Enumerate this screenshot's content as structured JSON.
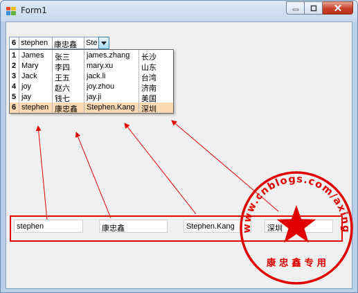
{
  "window": {
    "title": "Form1"
  },
  "combo": {
    "id": "6",
    "name": "stephen",
    "chinese": "康忠鑫",
    "email": "Ste"
  },
  "list": [
    {
      "id": "1",
      "name": "James",
      "chinese": "张三",
      "email": "james.zhang",
      "city": "长沙"
    },
    {
      "id": "2",
      "name": "Mary",
      "chinese": "李四",
      "email": "mary.xu",
      "city": "山东"
    },
    {
      "id": "3",
      "name": "Jack",
      "chinese": "王五",
      "email": "jack.li",
      "city": "台湾"
    },
    {
      "id": "4",
      "name": "joy",
      "chinese": "赵六",
      "email": "joy.zhou",
      "city": "济南"
    },
    {
      "id": "5",
      "name": "jay",
      "chinese": "钱七",
      "email": "jay.ji",
      "city": "美国"
    },
    {
      "id": "6",
      "name": "stephen",
      "chinese": "康忠鑫",
      "email": "Stephen.Kang",
      "city": "深圳"
    }
  ],
  "selected_index": 5,
  "fields": {
    "name": "stephen",
    "chinese": "康忠鑫",
    "email": "Stephen.Kang",
    "city": "深圳"
  },
  "stamp": {
    "arc_text": "www.cnblogs.com/axing",
    "bottom_text": "康 忠 鑫 专 用"
  },
  "colors": {
    "annotation": "#e00000",
    "selection": "#fbd9b4"
  },
  "icons": {
    "minimize": "minimize-icon",
    "maximize": "maximize-icon",
    "close": "close-icon",
    "dropdown": "chevron-down-icon"
  }
}
